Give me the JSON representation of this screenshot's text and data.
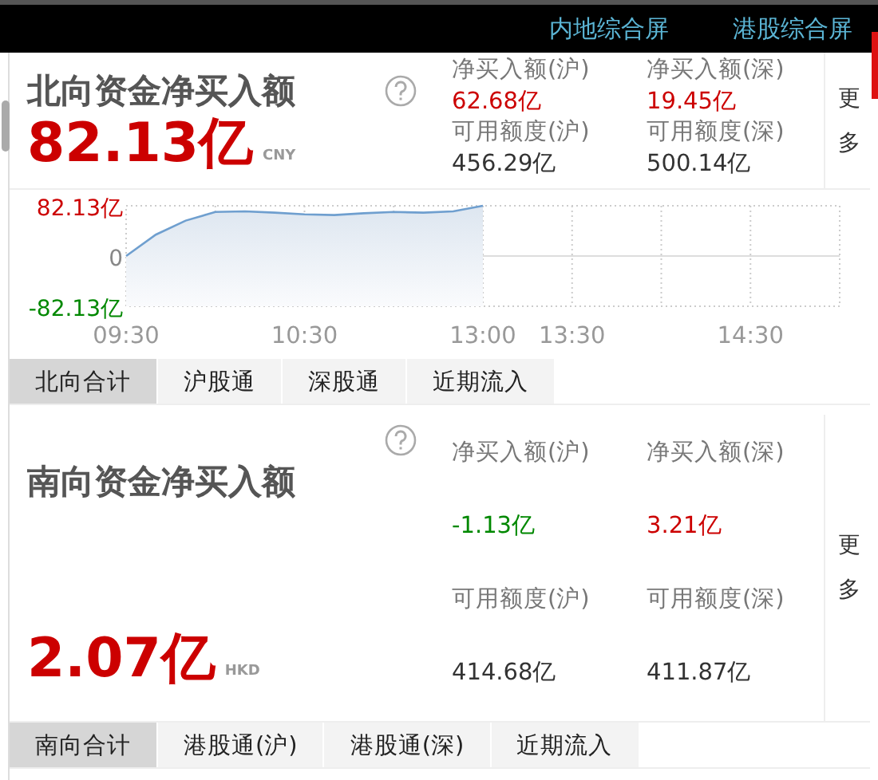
{
  "header_links": [
    {
      "label": "内地综合屏"
    },
    {
      "label": "港股综合屏"
    }
  ],
  "sections": [
    {
      "kind": "compact",
      "title": "北向资金净买入额",
      "total": "82.13亿",
      "currency": "CNY",
      "more": "更多",
      "stats": [
        {
          "label": "净买入额(沪)",
          "value": "62.68亿",
          "color": "#cc0000"
        },
        {
          "label": "净买入额(深)",
          "value": "19.45亿",
          "color": "#cc0000"
        },
        {
          "label": "可用额度(沪)",
          "value": "456.29亿",
          "color": "#333333"
        },
        {
          "label": "可用额度(深)",
          "value": "500.14亿",
          "color": "#333333"
        }
      ],
      "chart_data": {
        "type": "line",
        "grid": true,
        "categories": [
          "09:30",
          null,
          null,
          null,
          null,
          null,
          "10:30",
          null,
          null,
          null,
          null,
          null,
          "13:00",
          null,
          null,
          "13:30",
          null,
          null,
          null,
          null,
          null,
          "14:30",
          null,
          null,
          null
        ],
        "ylim": [
          -82.13,
          82.13
        ],
        "yticks": [
          {
            "value": 82.13,
            "label": "82.13亿"
          },
          {
            "value": 0,
            "label": "0"
          },
          {
            "value": -82.13,
            "label": "-82.13亿"
          }
        ],
        "series": [
          {
            "color": "#6f9fcf",
            "values": [
              0,
              35,
              58,
              72,
              73,
              71,
              68,
              67,
              70,
              72,
              71,
              73,
              82,
              null,
              null,
              null,
              null,
              null,
              null,
              null,
              null,
              null,
              null,
              null,
              null
            ]
          }
        ]
      },
      "tabs": [
        {
          "label": "北向合计",
          "selected": true
        },
        {
          "label": "沪股通",
          "selected": false
        },
        {
          "label": "深股通",
          "selected": false
        },
        {
          "label": "近期流入",
          "selected": false
        }
      ]
    },
    {
      "kind": "spaced",
      "title": "南向资金净买入额",
      "total": "2.07亿",
      "currency": "HKD",
      "more": "更多",
      "stats": [
        {
          "label": "净买入额(沪)",
          "value": "-1.13亿",
          "color": "#008800"
        },
        {
          "label": "净买入额(深)",
          "value": "3.21亿",
          "color": "#cc0000"
        },
        {
          "label": "可用额度(沪)",
          "value": "414.68亿",
          "color": "#333333"
        },
        {
          "label": "可用额度(深)",
          "value": "411.87亿",
          "color": "#333333"
        }
      ],
      "tabs": [
        {
          "label": "南向合计",
          "selected": true
        },
        {
          "label": "港股通(沪)",
          "selected": false
        },
        {
          "label": "港股通(深)",
          "selected": false
        },
        {
          "label": "近期流入",
          "selected": false
        }
      ]
    }
  ]
}
